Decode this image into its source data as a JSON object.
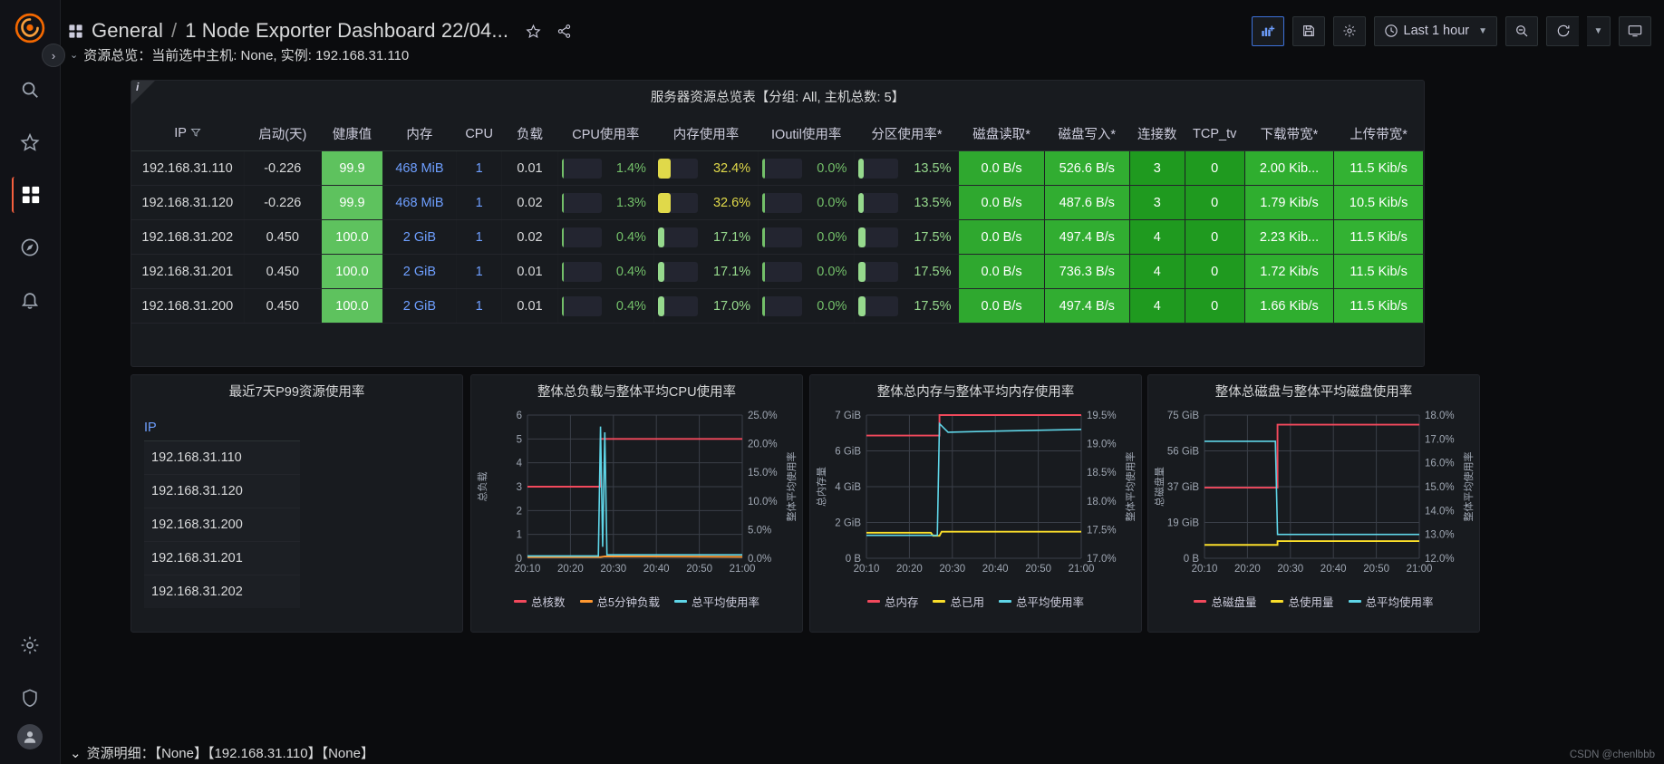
{
  "nav": {
    "items": [
      {
        "name": "search",
        "icon": "search-icon"
      },
      {
        "name": "starred",
        "icon": "star-icon"
      },
      {
        "name": "dashboards",
        "icon": "dashboards-icon"
      },
      {
        "name": "explore",
        "icon": "compass-icon"
      },
      {
        "name": "alerting",
        "icon": "bell-icon"
      },
      {
        "name": "configuration",
        "icon": "gear-icon"
      },
      {
        "name": "server-admin",
        "icon": "shield-icon"
      }
    ]
  },
  "header": {
    "folder": "General",
    "separator": "/",
    "title": "1 Node Exporter Dashboard 22/04...",
    "star_label": "☆",
    "share_label": "share",
    "time_range": "Last 1 hour",
    "buttons": {
      "add_panel": "add-panel",
      "save": "save-dashboard",
      "settings": "dashboard-settings",
      "zoom_out": "zoom-out-time-range",
      "refresh": "refresh-dashboard",
      "refresh_interval": "refresh-interval",
      "tv_mode": "cycle-view-mode"
    }
  },
  "row_top": {
    "chevron": "⌄",
    "label": "资源总览：当前选中主机: None, 实例: 192.168.31.110"
  },
  "row_bottom": {
    "chevron": "⌄",
    "label": "资源明细：【None】【192.168.31.110】【None】"
  },
  "table_panel": {
    "title": "服务器资源总览表【分组: All, 主机总数: 5】",
    "info_marker": "i",
    "columns": [
      "IP",
      "启动(天)",
      "健康值",
      "内存",
      "CPU",
      "负载",
      "CPU使用率",
      "内存使用率",
      "IOutil使用率",
      "分区使用率*",
      "磁盘读取*",
      "磁盘写入*",
      "连接数",
      "TCP_tv",
      "下载带宽*",
      "上传带宽*"
    ],
    "rows": [
      {
        "ip": "192.168.31.110",
        "uptime": "-0.226",
        "health": "99.9",
        "memory": "468 MiB",
        "cpu": "1",
        "load": "0.01",
        "cpu_usage": {
          "value": "1.4%",
          "pct": 1.4,
          "color": "#73bf69"
        },
        "mem_usage": {
          "value": "32.4%",
          "pct": 32.4,
          "color": "#e0d94a"
        },
        "ioutil": {
          "value": "0.0%",
          "pct": 0.0,
          "color": "#73bf69"
        },
        "part_usage": {
          "value": "13.5%",
          "pct": 13.5,
          "color": "#96d98d"
        },
        "disk_read": "0.0 B/s",
        "disk_write": "526.6 B/s",
        "conn": "3",
        "tcp_tv": "0",
        "down_bw": "2.00 Kib...",
        "up_bw": "11.5 Kib/s"
      },
      {
        "ip": "192.168.31.120",
        "uptime": "-0.226",
        "health": "99.9",
        "memory": "468 MiB",
        "cpu": "1",
        "load": "0.02",
        "cpu_usage": {
          "value": "1.3%",
          "pct": 1.3,
          "color": "#73bf69"
        },
        "mem_usage": {
          "value": "32.6%",
          "pct": 32.6,
          "color": "#e0d94a"
        },
        "ioutil": {
          "value": "0.0%",
          "pct": 0.0,
          "color": "#73bf69"
        },
        "part_usage": {
          "value": "13.5%",
          "pct": 13.5,
          "color": "#96d98d"
        },
        "disk_read": "0.0 B/s",
        "disk_write": "487.6 B/s",
        "conn": "3",
        "tcp_tv": "0",
        "down_bw": "1.79 Kib/s",
        "up_bw": "10.5 Kib/s"
      },
      {
        "ip": "192.168.31.202",
        "uptime": "0.450",
        "health": "100.0",
        "memory": "2 GiB",
        "cpu": "1",
        "load": "0.02",
        "cpu_usage": {
          "value": "0.4%",
          "pct": 0.4,
          "color": "#73bf69"
        },
        "mem_usage": {
          "value": "17.1%",
          "pct": 17.1,
          "color": "#96d98d"
        },
        "ioutil": {
          "value": "0.0%",
          "pct": 0.0,
          "color": "#73bf69"
        },
        "part_usage": {
          "value": "17.5%",
          "pct": 17.5,
          "color": "#96d98d"
        },
        "disk_read": "0.0 B/s",
        "disk_write": "497.4 B/s",
        "conn": "4",
        "tcp_tv": "0",
        "down_bw": "2.23 Kib...",
        "up_bw": "11.5 Kib/s"
      },
      {
        "ip": "192.168.31.201",
        "uptime": "0.450",
        "health": "100.0",
        "memory": "2 GiB",
        "cpu": "1",
        "load": "0.01",
        "cpu_usage": {
          "value": "0.4%",
          "pct": 0.4,
          "color": "#73bf69"
        },
        "mem_usage": {
          "value": "17.1%",
          "pct": 17.1,
          "color": "#96d98d"
        },
        "ioutil": {
          "value": "0.0%",
          "pct": 0.0,
          "color": "#73bf69"
        },
        "part_usage": {
          "value": "17.5%",
          "pct": 17.5,
          "color": "#96d98d"
        },
        "disk_read": "0.0 B/s",
        "disk_write": "736.3 B/s",
        "conn": "4",
        "tcp_tv": "0",
        "down_bw": "1.72 Kib/s",
        "up_bw": "11.5 Kib/s"
      },
      {
        "ip": "192.168.31.200",
        "uptime": "0.450",
        "health": "100.0",
        "memory": "2 GiB",
        "cpu": "1",
        "load": "0.01",
        "cpu_usage": {
          "value": "0.4%",
          "pct": 0.4,
          "color": "#73bf69"
        },
        "mem_usage": {
          "value": "17.0%",
          "pct": 17.0,
          "color": "#96d98d"
        },
        "ioutil": {
          "value": "0.0%",
          "pct": 0.0,
          "color": "#73bf69"
        },
        "part_usage": {
          "value": "17.5%",
          "pct": 17.5,
          "color": "#96d98d"
        },
        "disk_read": "0.0 B/s",
        "disk_write": "497.4 B/s",
        "conn": "4",
        "tcp_tv": "0",
        "down_bw": "1.66 Kib/s",
        "up_bw": "11.5 Kib/s"
      }
    ],
    "colors": {
      "health_green": "#5ec25e",
      "cell_green_mid": "#27a127",
      "cell_green_dark": "#1f9a1f",
      "blue_text": "#6e9fff"
    }
  },
  "p99_panel": {
    "title": "最近7天P99资源使用率",
    "column": "IP",
    "items": [
      "192.168.31.110",
      "192.168.31.120",
      "192.168.31.200",
      "192.168.31.201",
      "192.168.31.202"
    ]
  },
  "chart_data": [
    {
      "type": "line",
      "title": "整体总负载与整体平均CPU使用率",
      "ylabel": "总负载",
      "y2label": "整体平均使用率",
      "ylim": [
        0,
        6
      ],
      "yticks": [
        "0",
        "1",
        "2",
        "3",
        "4",
        "5",
        "6"
      ],
      "y2lim": [
        0,
        25
      ],
      "y2ticks": [
        "0.0%",
        "5.0%",
        "10.0%",
        "15.0%",
        "20.0%",
        "25.0%"
      ],
      "xticks": [
        "20:10",
        "20:20",
        "20:30",
        "20:40",
        "20:50",
        "21:00"
      ],
      "grid": true,
      "legend_position": "bottom",
      "series": [
        {
          "name": "总核数",
          "color": "#f2495c",
          "axis": "left",
          "points": [
            [
              0,
              3
            ],
            [
              34,
              3
            ],
            [
              34,
              5
            ],
            [
              100,
              5
            ]
          ]
        },
        {
          "name": "总5分钟负载",
          "color": "#ff9830",
          "axis": "left",
          "points": [
            [
              0,
              0.05
            ],
            [
              34,
              0.05
            ],
            [
              36,
              0.08
            ],
            [
              100,
              0.06
            ]
          ]
        },
        {
          "name": "总平均使用率",
          "color": "#5fd6e8",
          "axis": "right",
          "points": [
            [
              0,
              0.4
            ],
            [
              33,
              0.4
            ],
            [
              34,
              23
            ],
            [
              35,
              2
            ],
            [
              36,
              22
            ],
            [
              37,
              0.6
            ],
            [
              100,
              0.6
            ]
          ]
        }
      ]
    },
    {
      "type": "line",
      "title": "整体总内存与整体平均内存使用率",
      "ylabel": "总内存量",
      "y2label": "整体平均使用率",
      "ylim": [
        0,
        7
      ],
      "yticks": [
        "0 B",
        "2 GiB",
        "4 GiB",
        "6 GiB",
        "7 GiB"
      ],
      "y2lim": [
        17.0,
        19.5
      ],
      "y2ticks": [
        "17.0%",
        "17.5%",
        "18.0%",
        "18.5%",
        "19.0%",
        "19.5%"
      ],
      "xticks": [
        "20:10",
        "20:20",
        "20:30",
        "20:40",
        "20:50",
        "21:00"
      ],
      "grid": true,
      "legend_position": "bottom",
      "series": [
        {
          "name": "总内存",
          "color": "#f2495c",
          "axis": "left",
          "points": [
            [
              0,
              6
            ],
            [
              34,
              6
            ],
            [
              34,
              7
            ],
            [
              100,
              7
            ]
          ]
        },
        {
          "name": "总已用",
          "color": "#fade2a",
          "axis": "left",
          "points": [
            [
              0,
              1.25
            ],
            [
              30,
              1.25
            ],
            [
              31,
              1.1
            ],
            [
              34,
              1.1
            ],
            [
              35,
              1.3
            ],
            [
              100,
              1.3
            ]
          ]
        },
        {
          "name": "总平均使用率",
          "color": "#5fd6e8",
          "axis": "right",
          "points": [
            [
              0,
              17.4
            ],
            [
              33,
              17.4
            ],
            [
              34,
              19.35
            ],
            [
              38,
              19.2
            ],
            [
              60,
              19.22
            ],
            [
              100,
              19.25
            ]
          ]
        }
      ]
    },
    {
      "type": "line",
      "title": "整体总磁盘与整体平均磁盘使用率",
      "ylabel": "总磁盘量",
      "y2label": "整体平均使用率",
      "ylim": [
        0,
        75
      ],
      "yticks": [
        "0 B",
        "19 GiB",
        "37 GiB",
        "56 GiB",
        "75 GiB"
      ],
      "y2lim": [
        12.0,
        18.0
      ],
      "y2ticks": [
        "12.0%",
        "13.0%",
        "14.0%",
        "15.0%",
        "16.0%",
        "17.0%",
        "18.0%"
      ],
      "xticks": [
        "20:10",
        "20:20",
        "20:30",
        "20:40",
        "20:50",
        "21:00"
      ],
      "grid": true,
      "legend_position": "bottom",
      "series": [
        {
          "name": "总磁盘量",
          "color": "#f2495c",
          "axis": "left",
          "points": [
            [
              0,
              37
            ],
            [
              34,
              37
            ],
            [
              34,
              70
            ],
            [
              100,
              70
            ]
          ]
        },
        {
          "name": "总使用量",
          "color": "#fade2a",
          "axis": "left",
          "points": [
            [
              0,
              7
            ],
            [
              34,
              7
            ],
            [
              34,
              9
            ],
            [
              100,
              9
            ]
          ]
        },
        {
          "name": "总平均使用率",
          "color": "#5fd6e8",
          "axis": "right",
          "points": [
            [
              0,
              16.9
            ],
            [
              33,
              16.9
            ],
            [
              34,
              13.0
            ],
            [
              100,
              13.0
            ]
          ]
        }
      ]
    }
  ],
  "watermark": "CSDN @chenlbbb"
}
